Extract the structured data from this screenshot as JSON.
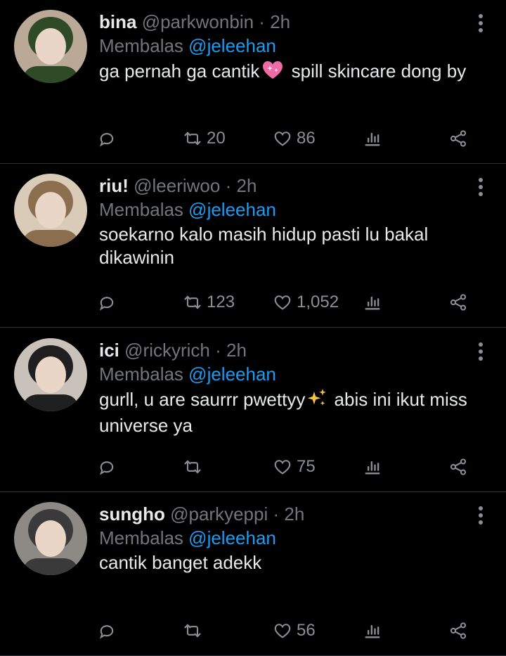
{
  "tweets": [
    {
      "name": "bina",
      "handle": "@parkwonbin",
      "separator": "·",
      "time": "2h",
      "replying_label": "Membalas",
      "replying_to": "@jeleehan",
      "text_before": "ga pernah ga cantik",
      "emoji": "sparkling-heart-icon",
      "text_after": " spill skincare dong by",
      "retweets": "20",
      "likes": "86",
      "avatar_colors": [
        "#b9a996",
        "#2f4a26"
      ]
    },
    {
      "name": "riu!",
      "handle": "@leeriwoo",
      "separator": "·",
      "time": "2h",
      "replying_label": "Membalas",
      "replying_to": "@jeleehan",
      "text_before": "soekarno kalo masih hidup pasti lu bakal dikawinin",
      "emoji": "",
      "text_after": "",
      "retweets": "123",
      "likes": "1,052",
      "avatar_colors": [
        "#d9cbb7",
        "#8a6e4d"
      ]
    },
    {
      "name": "ici",
      "handle": "@rickyrich",
      "separator": "·",
      "time": "2h",
      "replying_label": "Membalas",
      "replying_to": "@jeleehan",
      "text_before": "gurll, u are saurrr pwettyy",
      "emoji": "sparkles-icon",
      "text_after": " abis ini ikut miss universe ya",
      "retweets": "",
      "likes": "75",
      "avatar_colors": [
        "#c9c2bb",
        "#1f1f1f"
      ]
    },
    {
      "name": "sungho",
      "handle": "@parkyeppi",
      "separator": "·",
      "time": "2h",
      "replying_label": "Membalas",
      "replying_to": "@jeleehan",
      "text_before": "cantik banget adekk",
      "emoji": "",
      "text_after": "",
      "retweets": "",
      "likes": "56",
      "avatar_colors": [
        "#8d8a86",
        "#3b3a3a"
      ]
    }
  ],
  "colors": {
    "background": "#000000",
    "text": "#e7e9ea",
    "muted": "#71767b",
    "mention": "#1d9bf0",
    "divider": "#2f3336"
  }
}
